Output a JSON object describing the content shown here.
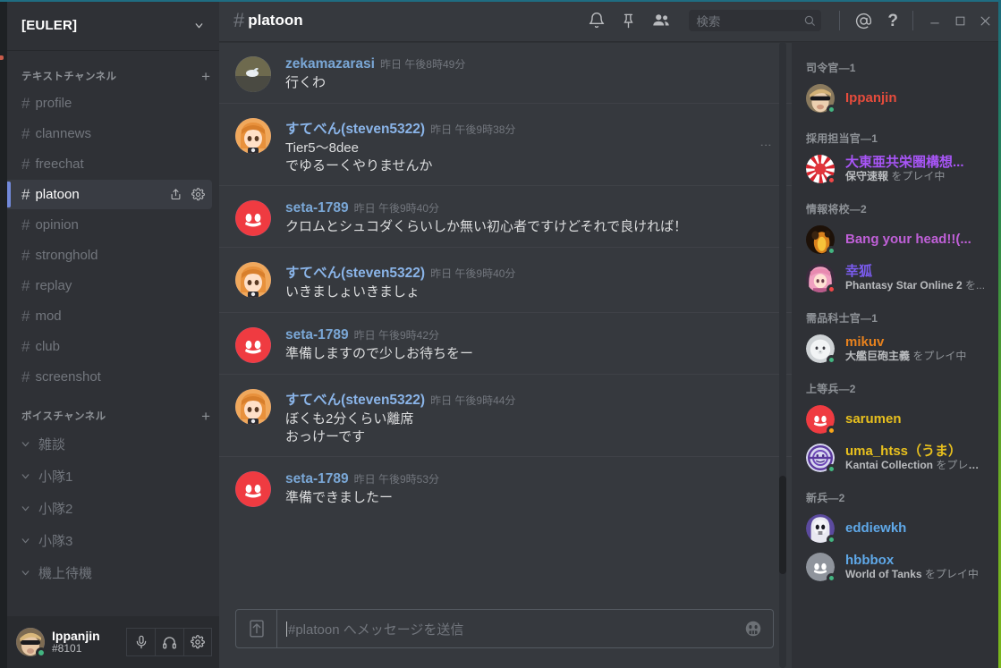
{
  "window": {
    "minimize_icon": "minimize-icon",
    "maximize_icon": "maximize-icon",
    "close_icon": "close-icon"
  },
  "guild": {
    "name": "[EULER]",
    "chevron_icon": "chevron-down-icon"
  },
  "sidebar": {
    "text_category": "テキストチャンネル",
    "voice_category": "ボイスチャンネル",
    "add_icon": "plus-icon",
    "text_channels": [
      {
        "name": "profile",
        "active": false
      },
      {
        "name": "clannews",
        "active": false
      },
      {
        "name": "freechat",
        "active": false
      },
      {
        "name": "platoon",
        "active": true
      },
      {
        "name": "opinion",
        "active": false
      },
      {
        "name": "stronghold",
        "active": false
      },
      {
        "name": "replay",
        "active": false
      },
      {
        "name": "mod",
        "active": false
      },
      {
        "name": "club",
        "active": false
      },
      {
        "name": "screenshot",
        "active": false
      }
    ],
    "active_channel_icons": [
      "invite-icon",
      "settings-gear-icon"
    ],
    "voice_channels": [
      {
        "name": "雑談"
      },
      {
        "name": "小隊1"
      },
      {
        "name": "小隊2"
      },
      {
        "name": "小隊3"
      },
      {
        "name": "機上待機"
      }
    ]
  },
  "user_panel": {
    "name": "Ippanjin",
    "tag": "#8101",
    "status": "online",
    "buttons": [
      {
        "icon": "microphone-icon"
      },
      {
        "icon": "headphones-icon"
      },
      {
        "icon": "settings-gear-icon"
      }
    ]
  },
  "topbar": {
    "hash": "#",
    "channel": "platoon",
    "icons": [
      {
        "name": "bell-icon"
      },
      {
        "name": "pin-icon"
      },
      {
        "name": "members-icon"
      }
    ],
    "search": {
      "placeholder": "検索",
      "value": "",
      "icon": "search-icon"
    },
    "mention_icon": "mention-icon",
    "help_icon": "help-icon"
  },
  "messages": [
    {
      "author": "zekamazarasi",
      "author_color": "#7aa7d6",
      "timestamp": "昨日 午後8時49分",
      "avatar": "photo-swan",
      "lines": [
        "行くわ"
      ],
      "has_more_menu": false
    },
    {
      "author": "すてべん(steven5322)",
      "author_color": "#8ab4e8",
      "timestamp": "昨日 午後9時38分",
      "avatar": "anime-girl",
      "lines": [
        "Tier5〜8dee",
        "でゆるーくやりませんか"
      ],
      "has_more_menu": true
    },
    {
      "author": "seta-1789",
      "author_color": "#7aa7d6",
      "timestamp": "昨日 午後9時40分",
      "avatar": "discord-red",
      "lines": [
        "クロムとシュコダくらいしか無い初心者ですけどそれで良ければ！"
      ],
      "has_more_menu": false
    },
    {
      "author": "すてべん(steven5322)",
      "author_color": "#8ab4e8",
      "timestamp": "昨日 午後9時40分",
      "avatar": "anime-girl",
      "lines": [
        "いきましょいきましょ"
      ],
      "has_more_menu": false
    },
    {
      "author": "seta-1789",
      "author_color": "#7aa7d6",
      "timestamp": "昨日 午後9時42分",
      "avatar": "discord-red",
      "lines": [
        "準備しますので少しお待ちをー"
      ],
      "has_more_menu": false
    },
    {
      "author": "すてべん(steven5322)",
      "author_color": "#8ab4e8",
      "timestamp": "昨日 午後9時44分",
      "avatar": "anime-girl",
      "lines": [
        "ぼくも2分くらい離席",
        "おっけーです"
      ],
      "has_more_menu": false
    },
    {
      "author": "seta-1789",
      "author_color": "#7aa7d6",
      "timestamp": "昨日 午後9時53分",
      "avatar": "discord-red",
      "lines": [
        "準備できましたー"
      ],
      "has_more_menu": false
    }
  ],
  "composer": {
    "placeholder": "#platoon へメッセージを送信",
    "value": "",
    "upload_icon": "upload-arrow-icon",
    "emoji_icon": "emoji-icon"
  },
  "member_list": {
    "groups": [
      {
        "title": "司令官—1",
        "members": [
          {
            "name": "Ippanjin",
            "name_color": "#e74c3c",
            "status": "online",
            "game": "",
            "avatar": "photo-sunglasses"
          }
        ]
      },
      {
        "title": "採用担当官—1",
        "members": [
          {
            "name": "大東亜共栄圏構想...",
            "name_color": "#a855f7",
            "status": "dnd",
            "game": "保守速報",
            "game_suffix": " をプレイ中",
            "avatar": "rising-sun"
          }
        ]
      },
      {
        "title": "情報将校—2",
        "members": [
          {
            "name": "Bang your head!!(...",
            "name_color": "#c060d8",
            "status": "online",
            "game": "",
            "avatar": "photo-fire"
          },
          {
            "name": "幸狐",
            "name_color": "#7b5cf0",
            "status": "dnd",
            "game": "Phantasy Star Online 2",
            "game_suffix": " を...",
            "avatar": "anime-pink"
          }
        ]
      },
      {
        "title": "需品科士官—1",
        "members": [
          {
            "name": "mikuv",
            "name_color": "#e8821e",
            "status": "online",
            "game": "大艦巨砲主義",
            "game_suffix": " をプレイ中",
            "avatar": "white-cat"
          }
        ]
      },
      {
        "title": "上等兵—2",
        "members": [
          {
            "name": "sarumen",
            "name_color": "#e8c01e",
            "status": "idle",
            "game": "",
            "avatar": "discord-red"
          },
          {
            "name": "uma_htss（うま）",
            "name_color": "#e8c01e",
            "status": "online",
            "game": "Kantai Collection",
            "game_suffix": " をプレイ中",
            "avatar": "purple-logo"
          }
        ]
      },
      {
        "title": "新兵—2",
        "members": [
          {
            "name": "eddiewkh",
            "name_color": "#5fa8e8",
            "status": "online",
            "game": "",
            "avatar": "reaper"
          },
          {
            "name": "hbbbox",
            "name_color": "#5fa8e8",
            "status": "online",
            "game": "World of Tanks",
            "game_suffix": " をプレイ中",
            "avatar": "discord-grey"
          }
        ]
      }
    ]
  },
  "colors": {
    "sidebar_bg": "#2f3136",
    "chat_bg": "#36393e",
    "accent_blurple": "#7289da",
    "online_green": "#43b581",
    "dnd_red": "#f04747",
    "idle_yellow": "#faa61a"
  }
}
